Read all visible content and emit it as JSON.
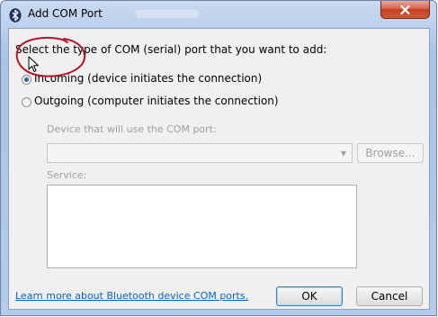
{
  "window": {
    "title": "Add COM Port"
  },
  "dialog": {
    "prompt": "Select the type of COM (serial) port that you want to add:",
    "incoming_label": "Incoming (device initiates the connection)",
    "outgoing_label": "Outgoing (computer initiates the connection)",
    "selected_option": "incoming",
    "device_label": "Device that will use the COM port:",
    "device_value": "",
    "browse_label": "Browse...",
    "service_label": "Service:",
    "service_value": "",
    "help_link": "Learn more about Bluetooth device COM ports.",
    "ok_label": "OK",
    "cancel_label": "Cancel"
  },
  "icons": {
    "title_icon": "bluetooth-icon",
    "close_icon": "close-icon",
    "combo_arrow": "chevron-down-icon",
    "cursor": "mouse-pointer-icon"
  },
  "colors": {
    "link": "#0c60c4",
    "annotation_circle": "#b3152a",
    "close_button": "#c2401f",
    "radio_dot": "#2d61a8"
  }
}
